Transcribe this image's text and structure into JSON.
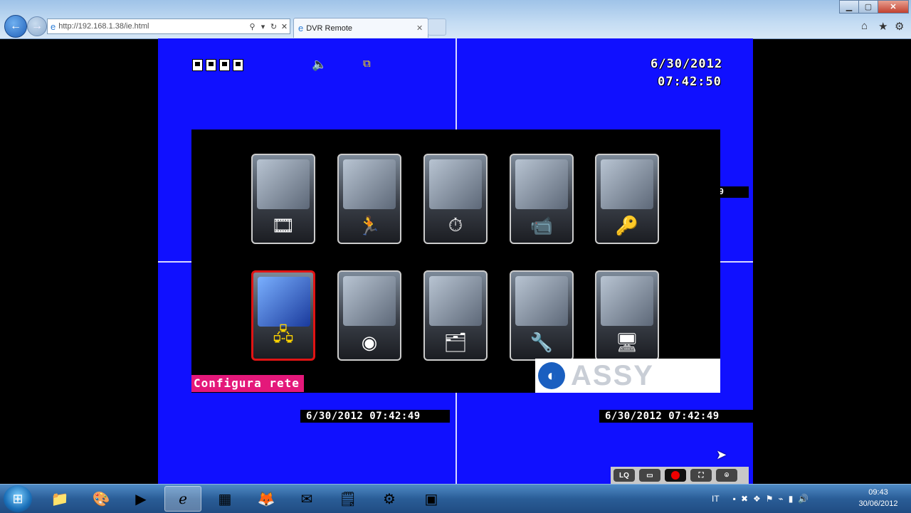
{
  "browser": {
    "address_url": "http://192.168.1.38/ie.html",
    "tab_title": "DVR Remote",
    "back_icon": "back-arrow-icon",
    "forward_icon": "forward-arrow-icon",
    "addr_tools": [
      "search-icon",
      "dropdown-icon",
      "refresh-icon",
      "stop-icon"
    ],
    "toolbar_icons": [
      "home-icon",
      "favorites-star-icon",
      "tools-gear-icon"
    ]
  },
  "dvr": {
    "osd_date": "6/30/2012",
    "osd_time": "07:42:50",
    "cam_timestamp_1": "6/30/2012 07:42:49",
    "cam_timestamp_2": "6/30/2012 07:42:49",
    "side_tag": "9",
    "menu": {
      "items": [
        {
          "name": "camera-record",
          "glyph": "🎞"
        },
        {
          "name": "motion",
          "glyph": "🏃"
        },
        {
          "name": "schedule",
          "glyph": "⏱"
        },
        {
          "name": "camera",
          "glyph": "📹"
        },
        {
          "name": "security",
          "glyph": "🔑"
        },
        {
          "name": "network",
          "glyph": "🖧",
          "selected": true
        },
        {
          "name": "ptz-dome",
          "glyph": "◉"
        },
        {
          "name": "files",
          "glyph": "🗂"
        },
        {
          "name": "tools",
          "glyph": "🔧"
        },
        {
          "name": "system",
          "glyph": "🖥"
        }
      ],
      "caption": "Configura rete"
    },
    "brand": "ASSY",
    "toolbar": {
      "lq_label": "LQ"
    }
  },
  "taskbar": {
    "tray_lang": "IT",
    "clock_time": "09:43",
    "clock_date": "30/06/2012"
  },
  "colors": {
    "dvr_background": "#1010ff",
    "caption_bg": "#e4187a",
    "selected_border": "#e01414"
  }
}
